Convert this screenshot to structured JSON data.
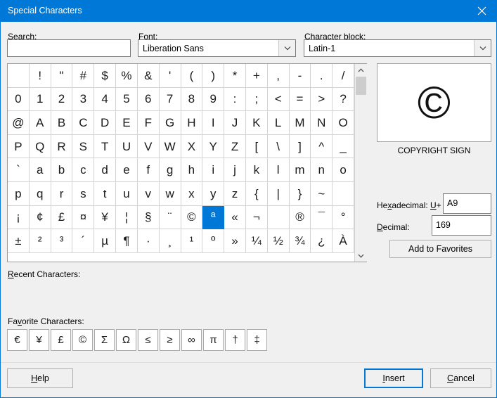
{
  "window": {
    "title": "Special Characters",
    "close_icon": "close-icon",
    "accent_color": "#0078d7"
  },
  "search": {
    "label": "Search:",
    "value": "",
    "placeholder": ""
  },
  "font": {
    "label": "Font:",
    "value": "Liberation Sans",
    "arrow_icon": "chevron-down-icon"
  },
  "character_block": {
    "label": "Character block:",
    "value": "Latin-1",
    "arrow_icon": "chevron-down-icon"
  },
  "grid": {
    "columns": 16,
    "rows": 8,
    "selected_index": 105,
    "characters": [
      " ",
      "!",
      "\"",
      "#",
      "$",
      "%",
      "&",
      "'",
      "(",
      ")",
      "*",
      "+",
      ",",
      "-",
      ".",
      "/",
      "0",
      "1",
      "2",
      "3",
      "4",
      "5",
      "6",
      "7",
      "8",
      "9",
      ":",
      ";",
      "<",
      "=",
      ">",
      "?",
      "@",
      "A",
      "B",
      "C",
      "D",
      "E",
      "F",
      "G",
      "H",
      "I",
      "J",
      "K",
      "L",
      "M",
      "N",
      "O",
      "P",
      "Q",
      "R",
      "S",
      "T",
      "U",
      "V",
      "W",
      "X",
      "Y",
      "Z",
      "[",
      "\\",
      "]",
      "^",
      "_",
      "`",
      "a",
      "b",
      "c",
      "d",
      "e",
      "f",
      "g",
      "h",
      "i",
      "j",
      "k",
      "l",
      "m",
      "n",
      "o",
      "p",
      "q",
      "r",
      "s",
      "t",
      "u",
      "v",
      "w",
      "x",
      "y",
      "z",
      "{",
      "|",
      "}",
      "~",
      " ",
      "¡",
      "¢",
      "£",
      "¤",
      "¥",
      "¦",
      "§",
      "¨",
      "©",
      "ª",
      "«",
      "¬",
      " ",
      "®",
      "¯",
      "°",
      "±",
      "²",
      "³",
      "´",
      "µ",
      "¶",
      "·",
      "¸",
      "¹",
      "º",
      "»",
      "¼",
      "½",
      "¾",
      "¿",
      "À"
    ],
    "scrollbar": {
      "up_icon": "chevron-up-icon",
      "down_icon": "chevron-down-icon"
    }
  },
  "preview": {
    "glyph": "©",
    "name": "COPYRIGHT SIGN"
  },
  "hexadecimal": {
    "label": "Hexadecimal:",
    "prefix": "U+",
    "value": "A9"
  },
  "decimal": {
    "label": "Decimal:",
    "value": "169"
  },
  "add_to_favorites": {
    "label": "Add to Favorites"
  },
  "recent": {
    "label": "Recent Characters:",
    "characters": []
  },
  "favorites": {
    "label": "Favorite Characters:",
    "characters": [
      "€",
      "¥",
      "£",
      "©",
      "Σ",
      "Ω",
      "≤",
      "≥",
      "∞",
      "π",
      "†",
      "‡"
    ]
  },
  "buttons": {
    "help": "Help",
    "insert": "Insert",
    "cancel": "Cancel"
  }
}
